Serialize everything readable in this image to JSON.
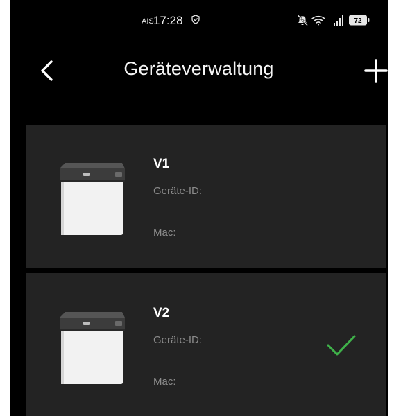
{
  "status_bar": {
    "carrier": "AIS",
    "time": "17:28",
    "battery": "72",
    "icons": [
      "shield-icon",
      "silent-icon",
      "wifi-icon",
      "signal-icon",
      "battery-icon"
    ]
  },
  "header": {
    "title": "Geräteverwaltung",
    "back_icon": "chevron-left-icon",
    "add_icon": "plus-icon"
  },
  "devices": [
    {
      "name": "V1",
      "id_label": "Geräte-ID:",
      "mac_label": "Mac:",
      "selected": false
    },
    {
      "name": "V2",
      "id_label": "Geräte-ID:",
      "mac_label": "Mac:",
      "selected": true
    }
  ],
  "colors": {
    "background": "#000000",
    "card": "#232323",
    "text_primary": "#ffffff",
    "text_secondary": "#8b8b8b",
    "check": "#3fb24a"
  }
}
